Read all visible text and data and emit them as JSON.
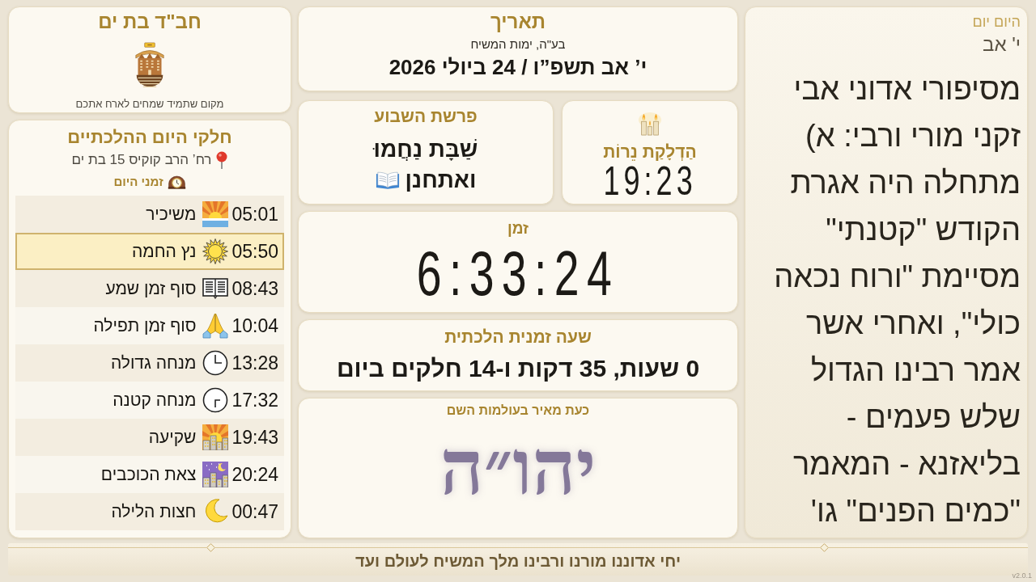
{
  "daily_study": {
    "title": "היום יום",
    "date": "י' אב",
    "text": "מסיפורי אדוני אבי זקני מורי ורבי: א) מתחלה היה אגרת הקודש \"קטנתי\" מסיימת \"ורוח נכאה כולי\", ואחרי אשר אמר רבינו הגדול שלש פעמים - בליאזנא - המאמר \"כמים הפנים\" גו'"
  },
  "date": {
    "title": "תאריך",
    "subtitle": "בע\"ה, ימות המשיח",
    "value": "י’ אב תשפ”ו / 24 ביולי 2026"
  },
  "candle_lighting": {
    "title": "הַדְלָקַת נֵרוֹת",
    "time": "19:23"
  },
  "parsha": {
    "title": "פרשת השבוע",
    "shabbat": "שַׁבָּת נַחֲמוּ",
    "name": "ואתחנן"
  },
  "clock": {
    "title": "זמן",
    "time": "6:33:24"
  },
  "halachic_hour": {
    "title": "שעה זמנית הלכתית",
    "value": "0 שעות, 35 דקות ו-14 חלקים ביום"
  },
  "divine_name": {
    "title": "כעת מאיר בעולמות השם",
    "name": "יהו״ה"
  },
  "org": {
    "title": "חב\"ד בת ים",
    "tagline": "מקום שתמיד שמחים לארח אתכם"
  },
  "zmanim": {
    "title": "חלקי היום ההלכתיים",
    "address": "רח’ הרב קוקיס 15 בת ים",
    "subtitle": "זמני היום",
    "rows": [
      {
        "time": "05:01",
        "name": "משיכיר",
        "selected": false
      },
      {
        "time": "05:50",
        "name": "נץ החמה",
        "selected": true
      },
      {
        "time": "08:43",
        "name": "סוף זמן שמע",
        "selected": false
      },
      {
        "time": "10:04",
        "name": "סוף זמן תפילה",
        "selected": false
      },
      {
        "time": "13:28",
        "name": "מנחה גדולה",
        "selected": false
      },
      {
        "time": "17:32",
        "name": "מנחה קטנה",
        "selected": false
      },
      {
        "time": "19:43",
        "name": "שקיעה",
        "selected": false
      },
      {
        "time": "20:24",
        "name": "צאת הכוכבים",
        "selected": false
      },
      {
        "time": "00:47",
        "name": "חצות הלילה",
        "selected": false
      }
    ]
  },
  "footer": {
    "slogan": "יחי אדוננו מורנו ורבינו מלך המשיח לעולם ועד",
    "version": "v2.0.1"
  }
}
